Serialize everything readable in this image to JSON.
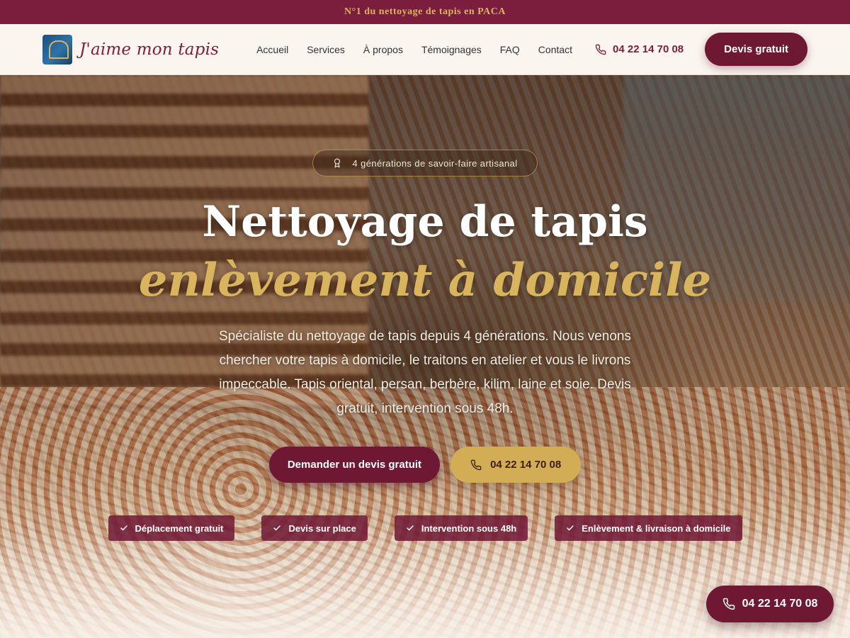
{
  "topbar": {
    "text": "N°1 du nettoyage de tapis en PACA"
  },
  "header": {
    "logo_text": "J'aime mon tapis",
    "nav": [
      "Accueil",
      "Services",
      "À propos",
      "Témoignages",
      "FAQ",
      "Contact"
    ],
    "phone": "04 22 14 70 08",
    "cta": "Devis gratuit"
  },
  "hero": {
    "badge": "4 générations de savoir-faire artisanal",
    "title_line1": "Nettoyage de tapis",
    "title_line2": "enlèvement à domicile",
    "description": "Spécialiste du nettoyage de tapis depuis 4 générations. Nous venons chercher votre tapis à domicile, le traitons en atelier et vous le livrons impeccable. Tapis oriental, persan, berbère, kilim, laine et soie. Devis gratuit, intervention sous 48h.",
    "cta_primary": "Demander un devis gratuit",
    "cta_phone": "04 22 14 70 08",
    "features": [
      "Déplacement gratuit",
      "Devis sur place",
      "Intervention sous 48h",
      "Enlèvement & livraison à domicile"
    ]
  },
  "floating": {
    "phone": "04 22 14 70 08"
  },
  "colors": {
    "primary": "#6e1834",
    "gold": "#d2ad55",
    "banner": "#7b1d3d",
    "header_bg": "#faf5ef"
  },
  "icons": {
    "phone": "phone-icon",
    "award": "award-icon",
    "check": "check-icon"
  }
}
